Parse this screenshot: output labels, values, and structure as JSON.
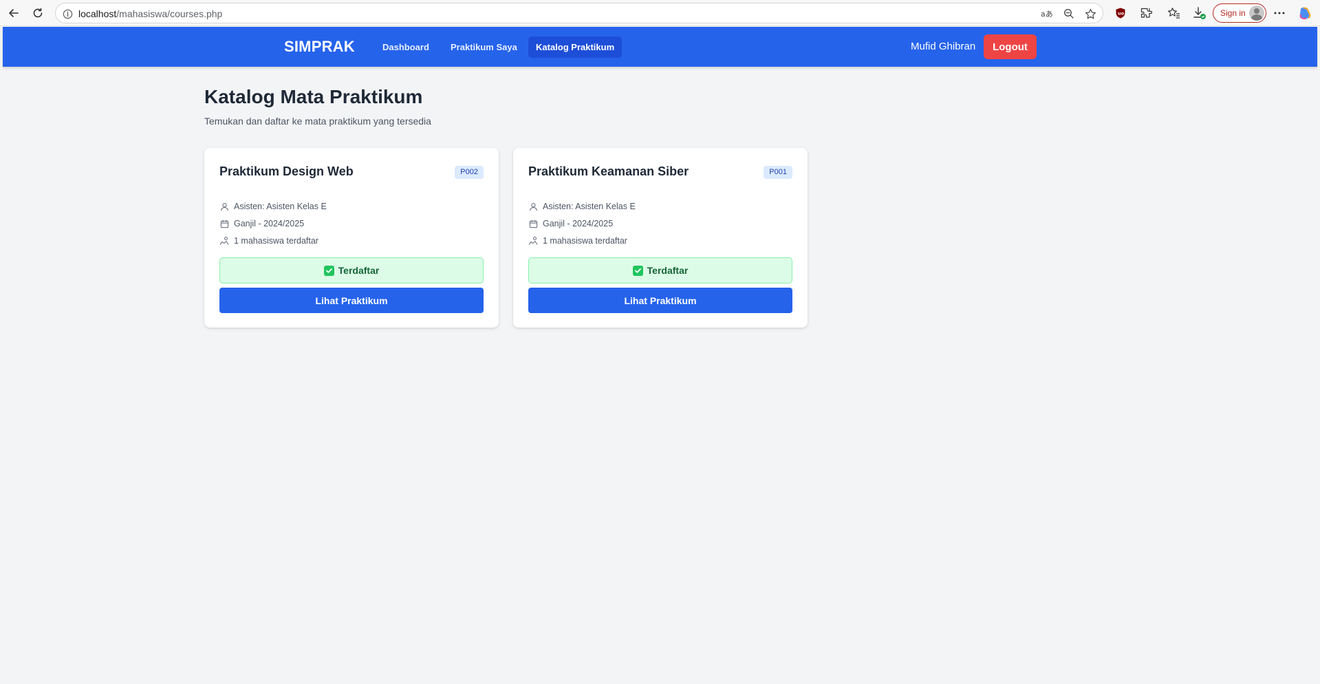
{
  "browser": {
    "url_host": "localhost",
    "url_path": "/mahasiswa/courses.php",
    "sign_in_label": "Sign in",
    "icons": [
      "back-arrow-icon",
      "reload-icon",
      "site-info-icon",
      "read-aloud-icon",
      "zoom-out-icon",
      "favorite-star-icon",
      "ublock-icon",
      "extensions-icon",
      "favorites-icon",
      "downloads-icon",
      "more-icon",
      "copilot-icon"
    ]
  },
  "nav": {
    "brand": "SIMPRAK",
    "links": [
      {
        "label": "Dashboard",
        "active": false
      },
      {
        "label": "Praktikum Saya",
        "active": false
      },
      {
        "label": "Katalog Praktikum",
        "active": true
      }
    ],
    "user_name": "Mufid Ghibran",
    "logout_label": "Logout"
  },
  "main": {
    "title": "Katalog Mata Praktikum",
    "subtitle": "Temukan dan daftar ke mata praktikum yang tersedia"
  },
  "courses": [
    {
      "title": "Praktikum Design Web",
      "code": "P002",
      "assistant": "Asisten: Asisten Kelas E",
      "semester": "Ganjil - 2024/2025",
      "enrolled": "1 mahasiswa terdaftar",
      "status": "Terdaftar",
      "action": "Lihat Praktikum"
    },
    {
      "title": "Praktikum Keamanan Siber",
      "code": "P001",
      "assistant": "Asisten: Asisten Kelas E",
      "semester": "Ganjil - 2024/2025",
      "enrolled": "1 mahasiswa terdaftar",
      "status": "Terdaftar",
      "action": "Lihat Praktikum"
    }
  ],
  "colors": {
    "primary": "#2563eb",
    "danger": "#ef4444",
    "success_bg": "#dcfce7",
    "success_text": "#166534",
    "page_bg": "#f3f4f6"
  }
}
